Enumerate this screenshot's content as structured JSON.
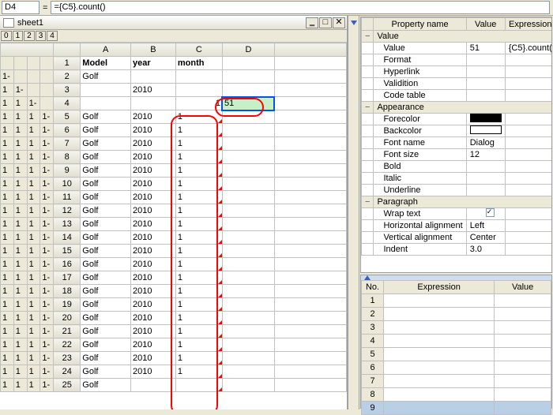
{
  "formulaBar": {
    "cellRef": "D4",
    "formula": "={C5}.count()"
  },
  "sheet": {
    "name": "sheet1",
    "outlineLevels": [
      "0",
      "1",
      "2",
      "3",
      "4"
    ],
    "columns": [
      "A",
      "B",
      "C",
      "D"
    ],
    "headerRow": {
      "A": "Model",
      "B": "year",
      "C": "month",
      "D": ""
    },
    "row2": {
      "A": "Golf"
    },
    "row3": {
      "B": "2010"
    },
    "row4": {
      "C": "1",
      "D": "51"
    },
    "dataRows": [
      {
        "n": 5,
        "A": "Golf",
        "B": "2010",
        "C": "1"
      },
      {
        "n": 6,
        "A": "Golf",
        "B": "2010",
        "C": "1"
      },
      {
        "n": 7,
        "A": "Golf",
        "B": "2010",
        "C": "1"
      },
      {
        "n": 8,
        "A": "Golf",
        "B": "2010",
        "C": "1"
      },
      {
        "n": 9,
        "A": "Golf",
        "B": "2010",
        "C": "1"
      },
      {
        "n": 10,
        "A": "Golf",
        "B": "2010",
        "C": "1"
      },
      {
        "n": 11,
        "A": "Golf",
        "B": "2010",
        "C": "1"
      },
      {
        "n": 12,
        "A": "Golf",
        "B": "2010",
        "C": "1"
      },
      {
        "n": 13,
        "A": "Golf",
        "B": "2010",
        "C": "1"
      },
      {
        "n": 14,
        "A": "Golf",
        "B": "2010",
        "C": "1"
      },
      {
        "n": 15,
        "A": "Golf",
        "B": "2010",
        "C": "1"
      },
      {
        "n": 16,
        "A": "Golf",
        "B": "2010",
        "C": "1"
      },
      {
        "n": 17,
        "A": "Golf",
        "B": "2010",
        "C": "1"
      },
      {
        "n": 18,
        "A": "Golf",
        "B": "2010",
        "C": "1"
      },
      {
        "n": 19,
        "A": "Golf",
        "B": "2010",
        "C": "1"
      },
      {
        "n": 20,
        "A": "Golf",
        "B": "2010",
        "C": "1"
      },
      {
        "n": 21,
        "A": "Golf",
        "B": "2010",
        "C": "1"
      },
      {
        "n": 22,
        "A": "Golf",
        "B": "2010",
        "C": "1"
      },
      {
        "n": 23,
        "A": "Golf",
        "B": "2010",
        "C": "1"
      },
      {
        "n": 24,
        "A": "Golf",
        "B": "2010",
        "C": "1"
      },
      {
        "n": 25,
        "A": "Golf",
        "B": "",
        "C": ""
      }
    ]
  },
  "properties": {
    "headers": [
      "Property name",
      "Value",
      "Expression"
    ],
    "groups": {
      "valueGroup": {
        "label": "Value",
        "props": {
          "Value": {
            "name": "Value",
            "value": "51",
            "expr": "{C5}.count("
          },
          "Format": {
            "name": "Format"
          },
          "Hyperlink": {
            "name": "Hyperlink"
          },
          "Validition": {
            "name": "Validition"
          },
          "CodeTable": {
            "name": "Code table"
          }
        }
      },
      "appearanceGroup": {
        "label": "Appearance",
        "props": {
          "Forecolor": {
            "name": "Forecolor",
            "swatch": "#000000"
          },
          "Backcolor": {
            "name": "Backcolor",
            "swatch": "#ffffff"
          },
          "FontName": {
            "name": "Font name",
            "value": "Dialog"
          },
          "FontSize": {
            "name": "Font size",
            "value": "12"
          },
          "Bold": {
            "name": "Bold"
          },
          "Italic": {
            "name": "Italic"
          },
          "Underline": {
            "name": "Underline"
          }
        }
      },
      "paragraphGroup": {
        "label": "Paragraph",
        "props": {
          "WrapText": {
            "name": "Wrap text",
            "checked": true
          },
          "HAlign": {
            "name": "Horizontal alignment",
            "value": "Left"
          },
          "VAlign": {
            "name": "Vertical alignment",
            "value": "Center"
          },
          "Indent": {
            "name": "Indent",
            "value": "3.0"
          }
        }
      }
    }
  },
  "expressionPanel": {
    "headers": [
      "No.",
      "Expression",
      "Value"
    ],
    "rows": [
      1,
      2,
      3,
      4,
      5,
      6,
      7,
      8,
      9
    ],
    "selected": 9
  },
  "colors": {
    "accentRed": "#ff0000",
    "selectedFill": "#c8f0c8"
  }
}
